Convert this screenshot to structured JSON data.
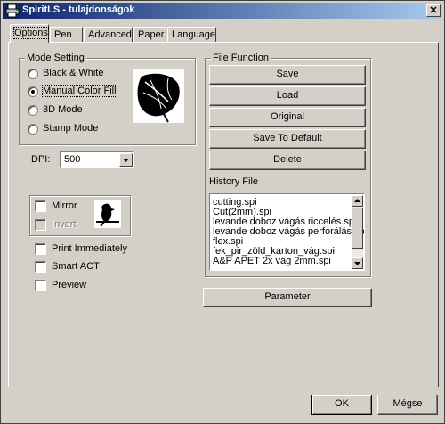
{
  "window": {
    "title": "SpiritLS - tulajdonságok",
    "close_symbol": "✕",
    "icon": "printer-icon"
  },
  "tabs": [
    {
      "label": "Options",
      "active": true
    },
    {
      "label": "Pen",
      "active": false
    },
    {
      "label": "Advanced",
      "active": false
    },
    {
      "label": "Paper",
      "active": false
    },
    {
      "label": "Language",
      "active": false
    }
  ],
  "mode_setting": {
    "legend": "Mode Setting",
    "options": [
      {
        "label": "Black & White",
        "selected": false
      },
      {
        "label": "Manual Color Fill",
        "selected": true
      },
      {
        "label": "3D Mode",
        "selected": false
      },
      {
        "label": "Stamp Mode",
        "selected": false
      }
    ],
    "preview_icon": "anthurium-leaf-image"
  },
  "dpi": {
    "label": "DPI:",
    "value": "500"
  },
  "mirror_group": {
    "mirror_label": "Mirror",
    "mirror_checked": false,
    "invert_label": "Invert",
    "invert_checked": false,
    "invert_enabled": false,
    "preview_icon": "bird-on-branch-image"
  },
  "options": [
    {
      "label": "Print Immediately",
      "checked": false
    },
    {
      "label": "Smart ACT",
      "checked": false
    },
    {
      "label": "Preview",
      "checked": false
    }
  ],
  "file_function": {
    "legend": "File Function",
    "buttons": {
      "save": "Save",
      "load": "Load",
      "original": "Original",
      "save_default": "Save To Default",
      "delete": "Delete"
    },
    "history_label": "History File",
    "history_files": [
      "cutting.spi",
      "Cut(2mm).spi",
      "levande doboz vágás riccelés.spi",
      "levande doboz vágás perforálás.spi",
      "flex.spi",
      "fek_pir_zöld_karton_vág.spi",
      "A&P APET 2x vág 2mm.spi"
    ]
  },
  "parameter_button": "Parameter",
  "footer": {
    "ok": "OK",
    "cancel": "Mégse"
  },
  "colors": {
    "face": "#d4d0c8",
    "title_start": "#0a246a",
    "title_end": "#a6caf0"
  }
}
